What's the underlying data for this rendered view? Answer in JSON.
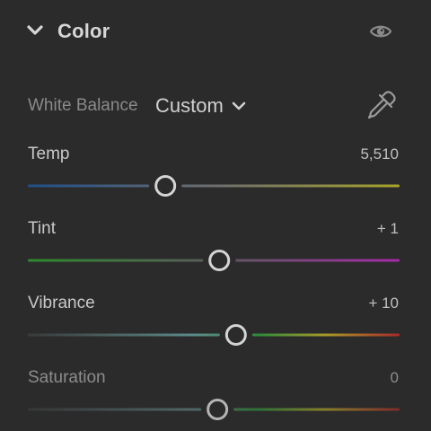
{
  "panel": {
    "title": "Color",
    "expanded": true
  },
  "white_balance": {
    "label": "White Balance",
    "value": "Custom"
  },
  "sliders": [
    {
      "key": "temp",
      "label": "Temp",
      "value": "5,510",
      "position": 0.37,
      "colors": {
        "left": "#1f4f8a",
        "mid": "#6e6e6e",
        "right": "#a7a52a"
      },
      "dim": false
    },
    {
      "key": "tint",
      "label": "Tint",
      "value": "+ 1",
      "position": 0.515,
      "colors": {
        "left": "#2d8a2d",
        "mid": "#5a5a5a",
        "right": "#a52aa8"
      },
      "dim": false
    },
    {
      "key": "vibrance",
      "label": "Vibrance",
      "value": "+ 10",
      "position": 0.56,
      "colors": {
        "left": "#3a3a3a",
        "mid": "#5c8a8a",
        "right": "#a82a2a",
        "spectrum": true
      },
      "dim": false
    },
    {
      "key": "saturation",
      "label": "Saturation",
      "value": "0",
      "position": 0.51,
      "colors": {
        "left": "#3a3a3a",
        "mid": "#5c7a7a",
        "right": "#9a2a2a",
        "spectrum": true
      },
      "dim": true
    }
  ],
  "colors": {
    "background": "#2b2b2b",
    "knob_stroke": "#d4d4d4",
    "text": "#c8c8c8"
  }
}
